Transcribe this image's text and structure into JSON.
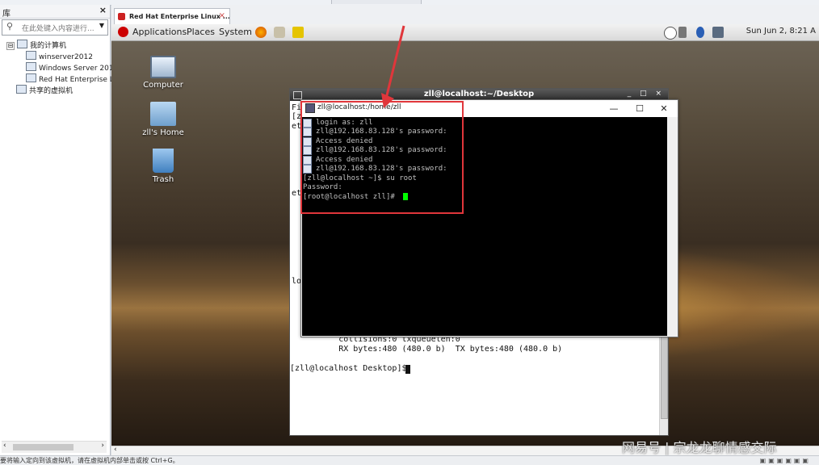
{
  "library": {
    "title": "库",
    "close": "×",
    "search_placeholder": "在此处键入内容进行...",
    "tree": [
      {
        "label": "我的计算机",
        "toggle": "⊟"
      },
      {
        "label": "winserver2012"
      },
      {
        "label": "Windows Server 201"
      },
      {
        "label": "Red Hat Enterprise L"
      },
      {
        "label": "共享的虚拟机"
      }
    ]
  },
  "status_bar": {
    "text": "要将输入定向到该虚拟机，请在虚拟机内部单击或按 Ctrl+G。"
  },
  "vm_tab": {
    "label": "Red Hat Enterprise Linux ...",
    "close": "×"
  },
  "gnome_panel": {
    "menus": [
      "Applications",
      "Places",
      "System"
    ],
    "clock": "Sun Jun  2,  8:21 A"
  },
  "desktop": {
    "icons": [
      {
        "label": "Computer",
        "icon": "computer-icon"
      },
      {
        "label": "zll's Home",
        "icon": "home-folder-icon"
      },
      {
        "label": "Trash",
        "icon": "trash-icon"
      }
    ]
  },
  "back_terminal": {
    "title": "zll@localhost:~/Desktop",
    "controls": "_ □ ×",
    "lines": [
      {
        "text": "[z",
        "row": 0
      },
      {
        "text": "et",
        "row": 1
      },
      {
        "text": "et",
        "row": 8
      },
      {
        "text": "lo",
        "row": 17
      },
      {
        "text": "          collisions:0 txqueuelen:0",
        "row": 23
      },
      {
        "text": "          RX bytes:480 (480.0 b)  TX bytes:480 (480.0 b)",
        "row": 24
      },
      {
        "text": "[zll@localhost Desktop]$ ",
        "row": 26
      }
    ],
    "left_edge_char": "Fi"
  },
  "putty": {
    "title": "zll@localhost:/home/zll",
    "controls": [
      "—",
      "☐",
      "✕"
    ],
    "lines": [
      "login as: zll",
      "zll@192.168.83.128's password:",
      "Access denied",
      "zll@192.168.83.128's password:",
      "Access denied",
      "zll@192.168.83.128's password:",
      "[zll@localhost ~]$ su root",
      "Password:",
      "[root@localhost zll]# "
    ]
  },
  "watermark": "网易号 | 宗龙龙聊情感交际",
  "colors": {
    "annotation_red": "#e0363b",
    "terminal_bg": "#000000",
    "cursor_green": "#00ff00"
  }
}
